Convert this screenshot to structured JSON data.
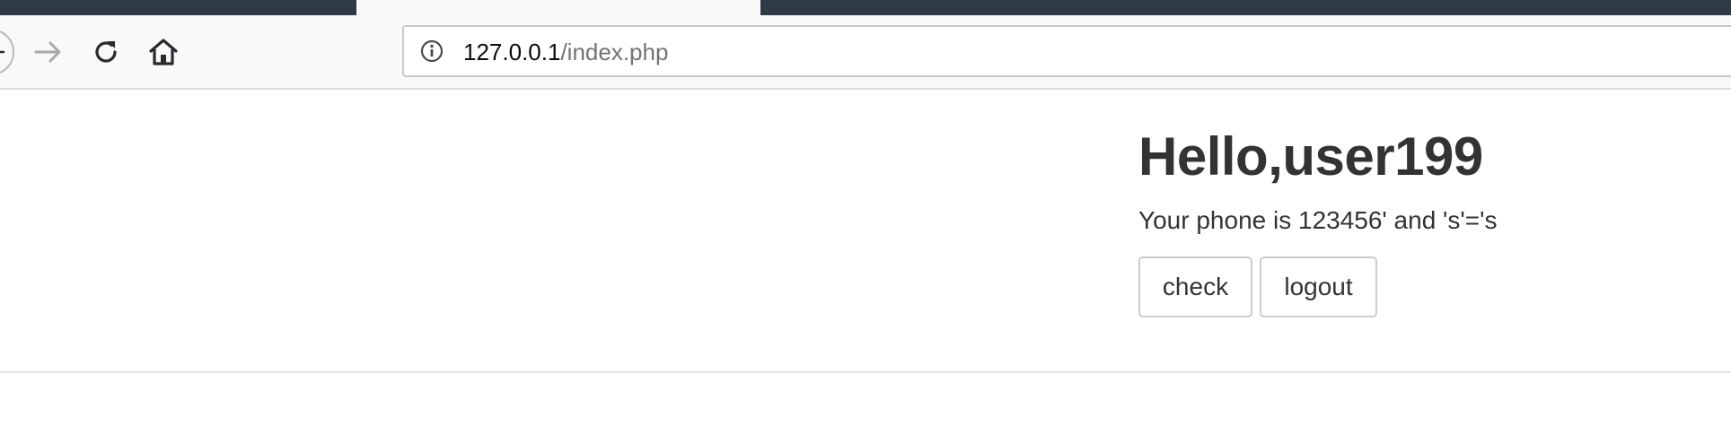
{
  "browser": {
    "url_host": "127.0.0.1",
    "url_path": "/index.php",
    "icons": {
      "back": "back-arrow-icon",
      "forward": "forward-arrow-icon",
      "reload": "reload-icon",
      "home": "home-icon",
      "site_info": "info-icon"
    }
  },
  "page": {
    "greeting": "Hello,user199",
    "phone_text": "Your phone is 123456' and 's'='s",
    "check_label": "check",
    "logout_label": "logout"
  }
}
